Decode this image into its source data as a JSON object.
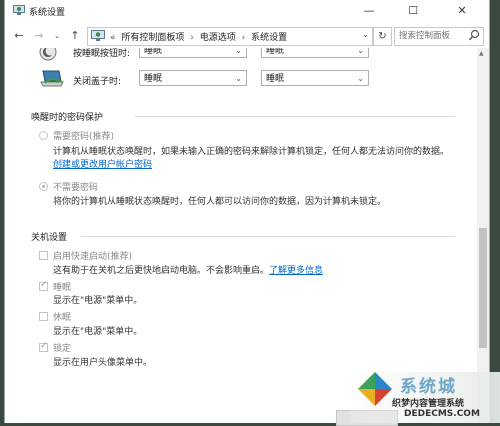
{
  "window": {
    "title": "系统设置",
    "minimize_glyph": "—",
    "maximize_glyph": "☐",
    "close_glyph": "✕"
  },
  "nav": {
    "back_glyph": "←",
    "forward_glyph": "→",
    "history_glyph": "⌄",
    "up_glyph": "↑",
    "breadcrumb_prefix": "«",
    "breadcrumbs": [
      "所有控制面板项",
      "电源选项",
      "系统设置"
    ],
    "breadcrumb_sep": "›",
    "dropdown_glyph": "⌄",
    "refresh_glyph": "↻",
    "search_placeholder": "搜索控制面板"
  },
  "power_buttons": {
    "rows": [
      {
        "label": "按睡眠按钮时:",
        "battery_value": "睡眠",
        "plugged_value": "睡眠",
        "icon": "sleep-button-icon"
      },
      {
        "label": "关闭盖子时:",
        "battery_value": "睡眠",
        "plugged_value": "睡眠",
        "icon": "laptop-lid-icon"
      }
    ],
    "dropdown_glyph": "⌄"
  },
  "password_section": {
    "title": "唤醒时的密码保护",
    "require": {
      "label": "需要密码(推荐)",
      "desc": "计算机从睡眠状态唤醒时，如果未输入正确的密码来解除计算机锁定，任何人都无法访问你的数据。",
      "link": "创建或更改用户帐户密码"
    },
    "not_require": {
      "label": "不需要密码",
      "desc": "将你的计算机从睡眠状态唤醒时，任何人都可以访问你的数据，因为计算机未锁定。"
    }
  },
  "shutdown_section": {
    "title": "关机设置",
    "items": [
      {
        "label": "启用快速启动(推荐)",
        "desc": "这有助于在关机之后更快地启动电脑。不会影响重启。",
        "link": "了解更多信息",
        "checked": false
      },
      {
        "label": "睡眠",
        "desc": "显示在\"电源\"菜单中。",
        "checked": true
      },
      {
        "label": "休眠",
        "desc": "显示在\"电源\"菜单中。",
        "checked": false
      },
      {
        "label": "锁定",
        "desc": "显示在用户头像菜单中。",
        "checked": true
      }
    ]
  },
  "watermark": {
    "line1": "系统城",
    "line2": "织梦内容管理系统",
    "line3": "DEDECMS.COM",
    "colors": [
      "#2a86c8",
      "#3aa35a",
      "#e8b020",
      "#d8412f"
    ]
  }
}
